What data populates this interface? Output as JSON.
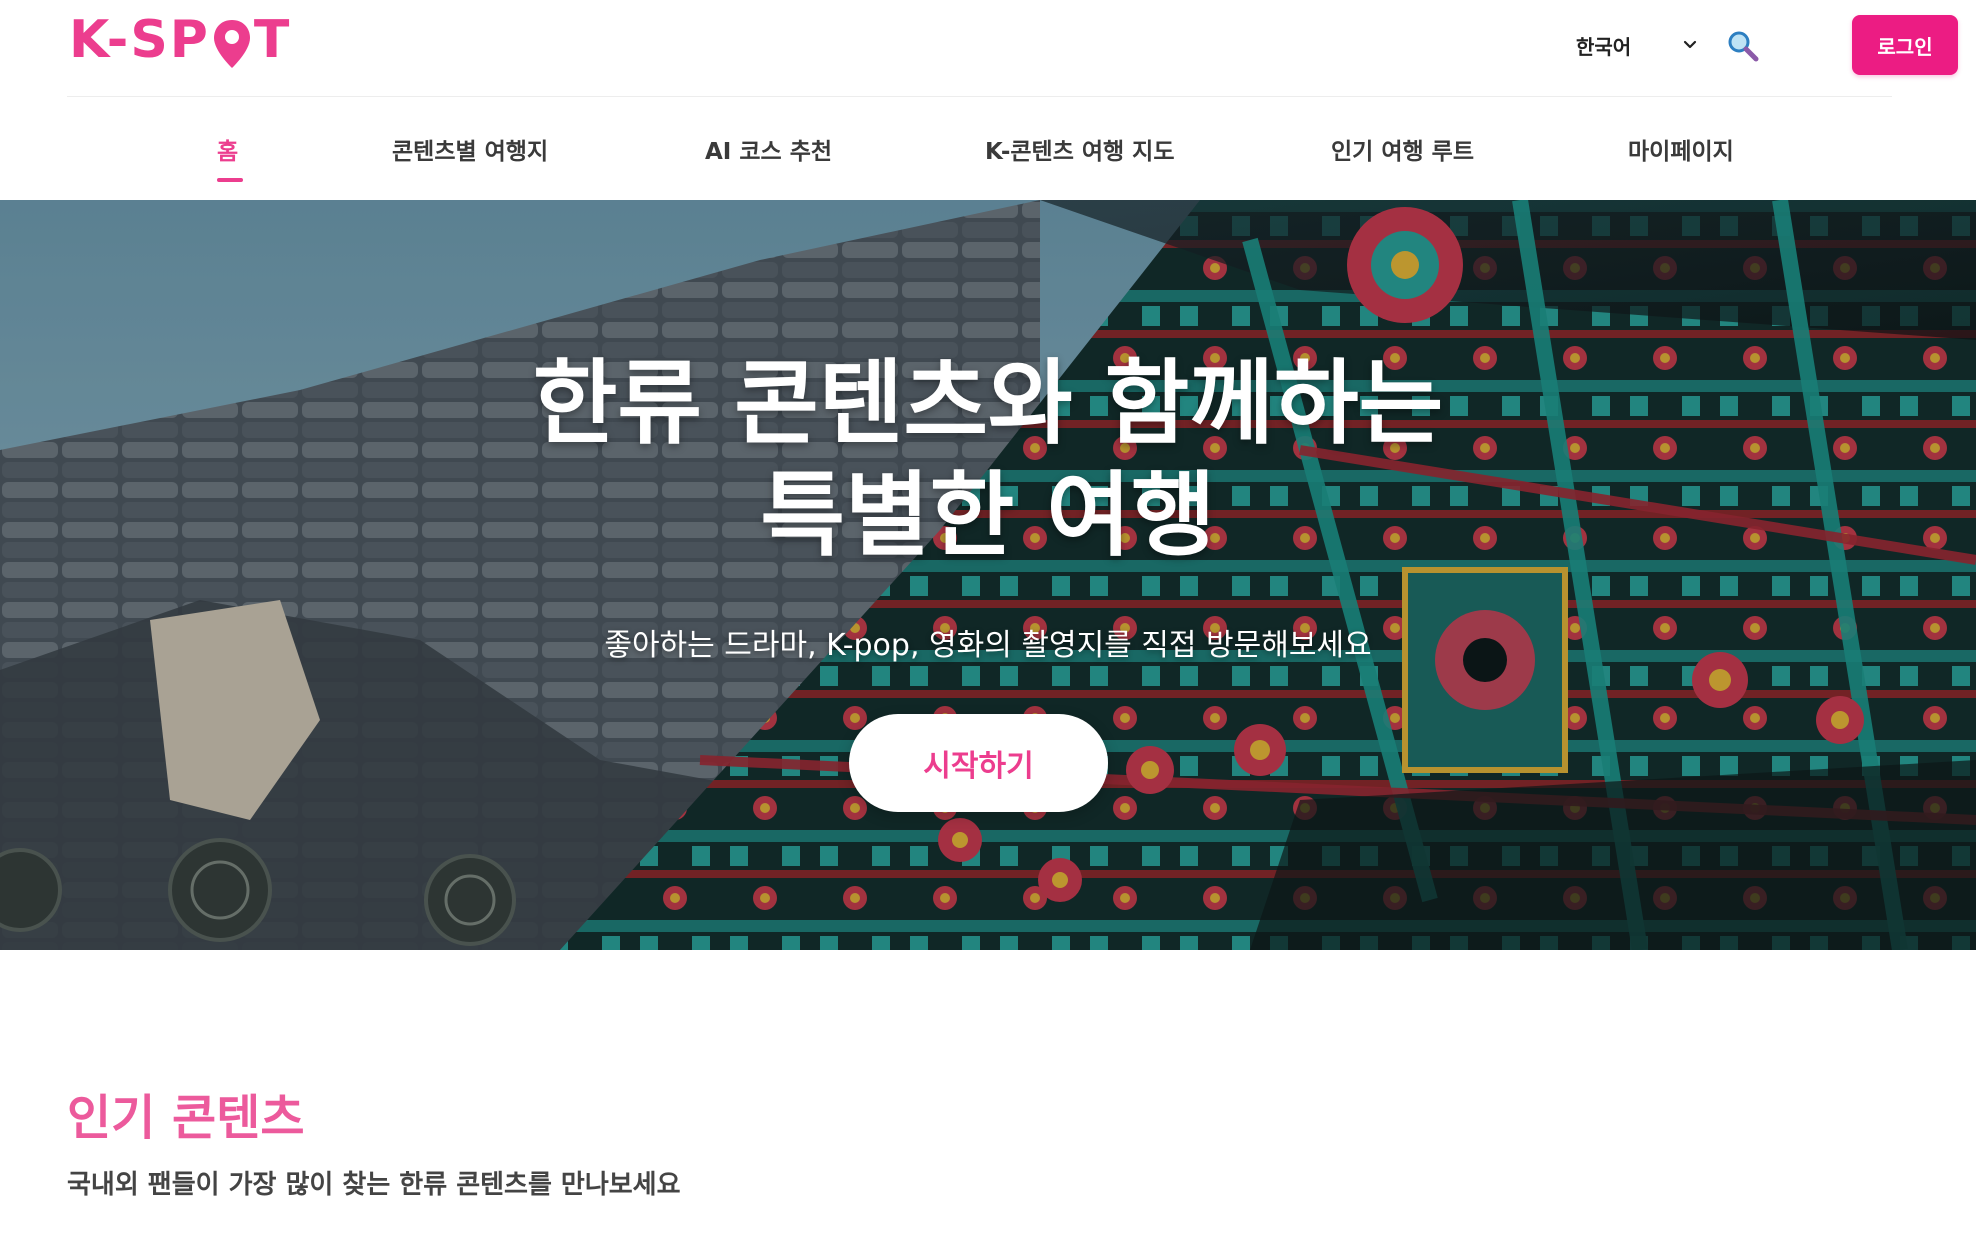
{
  "brand": {
    "logo_left": "K-SP",
    "logo_right": "T",
    "accent_color": "#ec3d8e",
    "button_color": "#ec1c83"
  },
  "header": {
    "language": "한국어",
    "search_icon": "search-icon",
    "login_label": "로그인"
  },
  "nav": {
    "items": [
      {
        "label": "홈",
        "active": true
      },
      {
        "label": "콘텐츠별 여행지",
        "active": false
      },
      {
        "label": "AI 코스 추천",
        "active": false
      },
      {
        "label": "K-콘텐츠 여행 지도",
        "active": false
      },
      {
        "label": "인기 여행 루트",
        "active": false
      },
      {
        "label": "마이페이지",
        "active": false
      }
    ]
  },
  "hero": {
    "title_line1": "한류 콘텐츠와 함께하는",
    "title_line2": "특별한 여행",
    "subtitle": "좋아하는 드라마, K-pop, 영화의 촬영지를 직접 방문해보세요",
    "cta_label": "시작하기"
  },
  "section": {
    "title": "인기 콘텐츠",
    "subtitle": "국내외 팬들이 가장 많이 찾는 한류 콘텐츠를 만나보세요"
  }
}
